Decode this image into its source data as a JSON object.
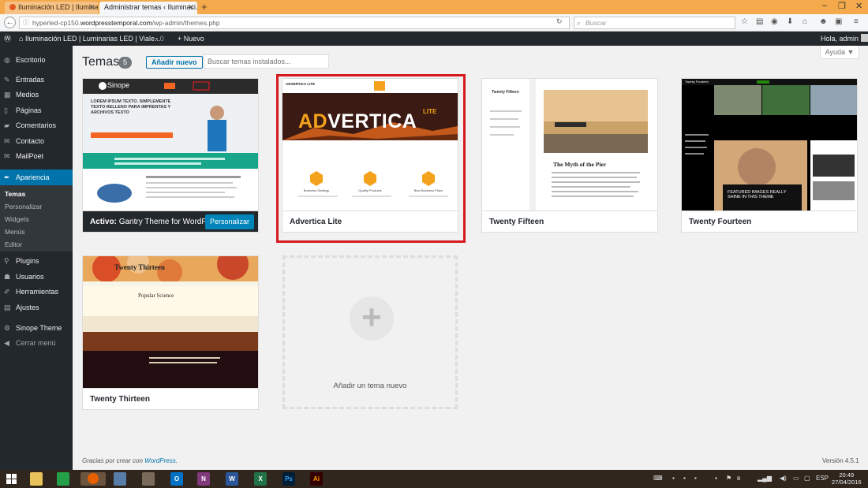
{
  "browser": {
    "tabs": [
      {
        "label": "Iluminación LED | Iluminari..."
      },
      {
        "label": "Administrar temas ‹ Iluminaci..."
      }
    ],
    "url_prefix": "hyperled-cp150.",
    "url_domain": "wordpresstemporal.com",
    "url_path": "/wp-admin/themes.php",
    "search_placeholder": "Buscar"
  },
  "admin_bar": {
    "site_name": "Iluminación LED | Luminarias LED | Viale...",
    "comments_count": "0",
    "new_label": "Nuevo",
    "greeting": "Hola, admin"
  },
  "sidebar": {
    "items": [
      {
        "label": "Escritorio",
        "icon": "dashboard-icon"
      },
      {
        "label": "Entradas",
        "icon": "pin-icon"
      },
      {
        "label": "Medios",
        "icon": "media-icon"
      },
      {
        "label": "Páginas",
        "icon": "pages-icon"
      },
      {
        "label": "Comentarios",
        "icon": "comments-icon"
      },
      {
        "label": "Contacto",
        "icon": "mail-icon"
      },
      {
        "label": "MailPoet",
        "icon": "mailpoet-icon"
      },
      {
        "label": "Apariencia",
        "icon": "appearance-icon"
      },
      {
        "label": "Plugins",
        "icon": "plugins-icon"
      },
      {
        "label": "Usuarios",
        "icon": "users-icon"
      },
      {
        "label": "Herramientas",
        "icon": "tools-icon"
      },
      {
        "label": "Ajustes",
        "icon": "settings-icon"
      },
      {
        "label": "Sinope Theme",
        "icon": "gear-icon"
      },
      {
        "label": "Cerrar menú",
        "icon": "collapse-icon"
      }
    ],
    "submenu": [
      "Temas",
      "Personalizar",
      "Widgets",
      "Menús",
      "Editor"
    ]
  },
  "main": {
    "title": "Temas",
    "count": "5",
    "add_new_label": "Añadir nuevo",
    "search_placeholder": "Buscar temas instalados...",
    "help_label": "Ayuda ▼",
    "active_prefix": "Activo:",
    "active_theme": "Gantry Theme for WordPress",
    "customize_label": "Personalizar",
    "themes": [
      {
        "name": "Advertica Lite"
      },
      {
        "name": "Twenty Fifteen"
      },
      {
        "name": "Twenty Fourteen"
      },
      {
        "name": "Twenty Thirteen"
      }
    ],
    "add_theme_label": "Añadir un tema nuevo"
  },
  "screenshots": {
    "sinope_logo": "Sinope",
    "sinope_headline": "LOREM IPSUM TEXTO. SIMPLEMENTE TEXTO RELLENO PARA IMPRENTAS Y ARCHIVOS TEXTO",
    "advertica_brand": "ADVERTICA LITE",
    "advertica_title_a": "AD",
    "advertica_title_b": "VERTICA",
    "advertica_lite": "LITE",
    "advertica_features": [
      "Business Strategy",
      "Quality Products",
      "Best Business Plans"
    ],
    "fifteen_site": "Twenty Fifteen",
    "fifteen_post": "The Myth of the Pier",
    "fourteen_site": "Twenty Fourteen",
    "fourteen_featured": "FEATURED IMAGES REALLY SHINE IN THIS THEME",
    "thirteen_site": "Twenty Thirteen",
    "thirteen_post": "Popular Science"
  },
  "footer": {
    "thanks_prefix": "Gracias por crear con ",
    "thanks_link": "WordPress",
    "thanks_suffix": ".",
    "version": "Versión 4.5.1"
  },
  "taskbar": {
    "apps": [
      "explorer-icon",
      "store-icon",
      "firefox-icon",
      "calculator-icon",
      "paint-icon",
      "outlook-icon",
      "onenote-icon",
      "word-icon",
      "excel-icon",
      "photoshop-icon",
      "illustrator-icon"
    ],
    "lang": "ESP",
    "time": "20:49",
    "date": "27/04/2016"
  }
}
